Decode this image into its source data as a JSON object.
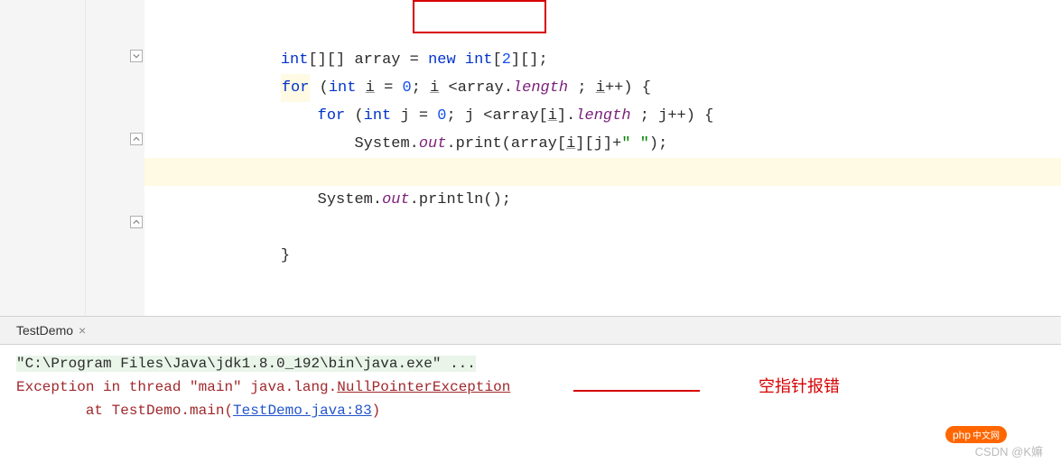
{
  "code": {
    "line1": {
      "prefix": "        ",
      "int": "int",
      "brackets1": "[][] array = ",
      "new": "new",
      "space": " ",
      "int2": "int",
      "dims": "[",
      "two": "2",
      "dims2": "][];"
    },
    "line2": {
      "prefix": "        ",
      "for": "for",
      "open": " (",
      "int": "int",
      "var": " ",
      "ivar": "i",
      "eq": " = ",
      "zero": "0",
      "semi": "; ",
      "ivar2": "i",
      "cond": " <array.",
      "length": "length",
      "end": " ; ",
      "ivar3": "i",
      "inc": "++) {"
    },
    "line3": {
      "prefix": "            ",
      "for": "for",
      "open": " (",
      "int": "int",
      "jdecl": " j = ",
      "zero": "0",
      "semi": "; j <array[",
      "ivar": "i",
      "close1": "].",
      "length": "length",
      "end": " ; j++) {"
    },
    "line4": {
      "prefix": "                System.",
      "out": "out",
      "print": ".print(array[",
      "ivar": "i",
      "mid": "][j]+",
      "str": "\" \"",
      "end": ");"
    },
    "line5": {
      "prefix": "            }"
    },
    "line6": {
      "prefix": "            System.",
      "out": "out",
      "println": ".println();"
    },
    "line7": {
      "blank": ""
    },
    "line8": {
      "prefix": "        }"
    }
  },
  "tab": {
    "name": "TestDemo",
    "close": "×"
  },
  "console": {
    "cmd": "\"C:\\Program Files\\Java\\jdk1.8.0_192\\bin\\java.exe\" ...",
    "exc_prefix": "Exception in thread \"main\" java.lang.",
    "exc_name": "NullPointerException",
    "at_prefix": "\tat TestDemo.main(",
    "link": "TestDemo.java:83",
    "at_suffix": ")"
  },
  "annotation": {
    "text": "空指针报错"
  },
  "watermark": {
    "text": "CSDN @K嫲",
    "badge1": "php",
    "badge2": "中文网"
  }
}
